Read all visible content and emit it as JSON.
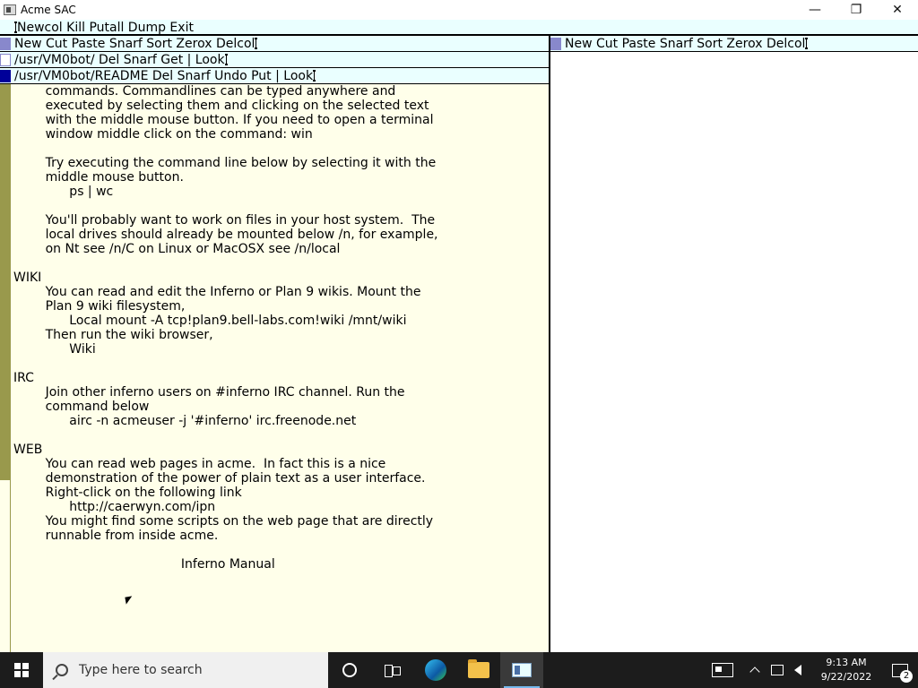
{
  "window": {
    "title": "Acme SAC",
    "controls": {
      "minimize": "—",
      "maximize": "❐",
      "close": "✕"
    }
  },
  "main_tag": "Newcol Kill Putall Dump Exit",
  "left_column": {
    "tag": "New Cut Paste Snarf Sort Zerox Delcol",
    "windows": [
      {
        "tag": "/usr/VM0bot/ Del Snarf Get | Look"
      },
      {
        "tag": "/usr/VM0bot/README Del Snarf Undo Put | Look"
      }
    ],
    "body_lines": [
      "        commands. Commandlines can be typed anywhere and",
      "        executed by selecting them and clicking on the selected text",
      "        with the middle mouse button. If you need to open a terminal",
      "        window middle click on the command: win",
      "",
      "        Try executing the command line below by selecting it with the",
      "        middle mouse button.",
      "              ps | wc",
      "",
      "        You'll probably want to work on files in your host system.  The",
      "        local drives should already be mounted below /n, for example,",
      "        on Nt see /n/C on Linux or MacOSX see /n/local",
      "",
      "WIKI",
      "        You can read and edit the Inferno or Plan 9 wikis. Mount the",
      "        Plan 9 wiki filesystem,",
      "              Local mount -A tcp!plan9.bell-labs.com!wiki /mnt/wiki",
      "        Then run the wiki browser,",
      "              Wiki",
      "",
      "IRC",
      "        Join other inferno users on #inferno IRC channel. Run the",
      "        command below",
      "              airc -n acmeuser -j '#inferno' irc.freenode.net",
      "",
      "WEB",
      "        You can read web pages in acme.  In fact this is a nice",
      "        demonstration of the power of plain text as a user interface.",
      "        Right-click on the following link",
      "              http://caerwyn.com/ipn",
      "        You might find some scripts on the web page that are directly",
      "        runnable from inside acme.",
      "",
      "                                          Inferno Manual"
    ]
  },
  "right_column": {
    "tag": "New Cut Paste Snarf Sort Zerox Delcol"
  },
  "taskbar": {
    "search_placeholder": "Type here to search",
    "clock_time": "9:13 AM",
    "clock_date": "9/22/2022",
    "notification_count": "2"
  }
}
